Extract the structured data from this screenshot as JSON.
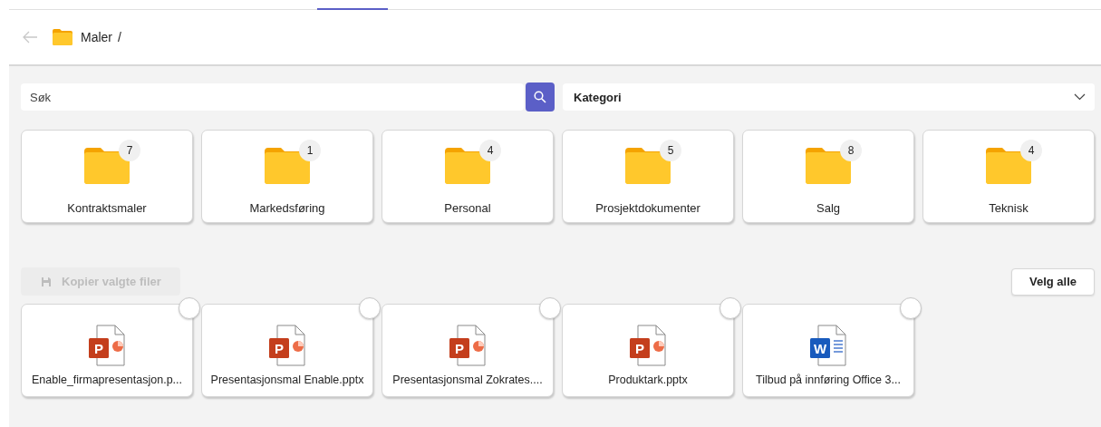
{
  "breadcrumb": {
    "folder": "Maler",
    "separator": "/"
  },
  "search": {
    "placeholder": "Søk"
  },
  "category": {
    "placeholder": "Kategori"
  },
  "folders": [
    {
      "name": "Kontraktsmaler",
      "count": "7"
    },
    {
      "name": "Markedsføring",
      "count": "1"
    },
    {
      "name": "Personal",
      "count": "4"
    },
    {
      "name": "Prosjektdokumenter",
      "count": "5"
    },
    {
      "name": "Salg",
      "count": "8"
    },
    {
      "name": "Teknisk",
      "count": "4"
    }
  ],
  "copy_button": {
    "label": "Kopier valgte filer",
    "disabled": true
  },
  "select_all_button": {
    "label": "Velg alle"
  },
  "files": [
    {
      "name": "Enable_firmapresentasjon.p...",
      "kind": "pptx",
      "icon_letter": "P",
      "selected": false
    },
    {
      "name": "Presentasjonsmal Enable.pptx",
      "kind": "pptx",
      "icon_letter": "P",
      "selected": false
    },
    {
      "name": "Presentasjonsmal Zokrates....",
      "kind": "pptx",
      "icon_letter": "P",
      "selected": false
    },
    {
      "name": "Produktark.pptx",
      "kind": "pptx",
      "icon_letter": "P",
      "selected": false
    },
    {
      "name": "Tilbud på innføring Office 3...",
      "kind": "docx",
      "icon_letter": "W",
      "selected": false
    }
  ]
}
